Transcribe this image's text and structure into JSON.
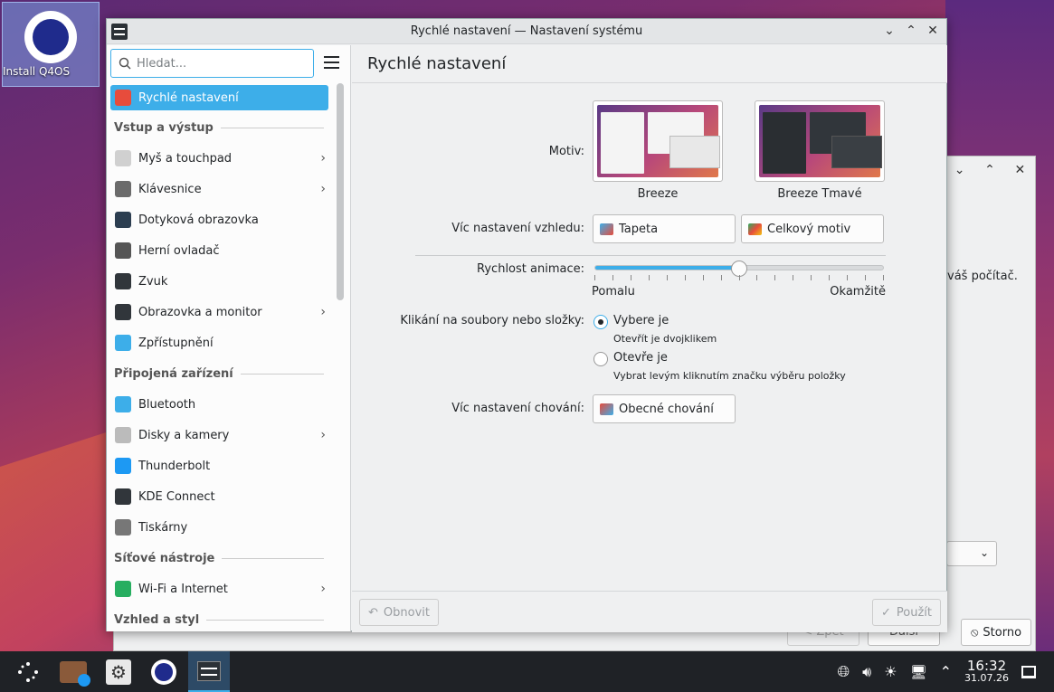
{
  "desktop": {
    "icon_label": "Install Q4OS"
  },
  "back_window": {
    "text": "váš počítač.",
    "combo": "⌄",
    "zpet": "< Zpět",
    "dalsi": "Další",
    "storno": "Storno",
    "buttons": [
      "⌄",
      "⌃",
      "✕"
    ]
  },
  "window": {
    "title": "Rychlé nastavení — Nastavení systému",
    "controls": [
      "⌄",
      "⌃",
      "✕"
    ]
  },
  "sidebar": {
    "search_placeholder": "Hledat...",
    "items": [
      {
        "type": "item",
        "label": "Rychlé nastavení",
        "selected": true,
        "color": "#e74c3c"
      },
      {
        "type": "section",
        "label": "Vstup a výstup"
      },
      {
        "type": "item",
        "label": "Myš a touchpad",
        "chevron": true,
        "color": "#d0d0d0"
      },
      {
        "type": "item",
        "label": "Klávesnice",
        "chevron": true,
        "color": "#6b6b6b"
      },
      {
        "type": "item",
        "label": "Dotyková obrazovka",
        "color": "#2c3e50"
      },
      {
        "type": "item",
        "label": "Herní ovladač",
        "color": "#555"
      },
      {
        "type": "item",
        "label": "Zvuk",
        "color": "#31363b"
      },
      {
        "type": "item",
        "label": "Obrazovka a monitor",
        "chevron": true,
        "color": "#31363b"
      },
      {
        "type": "item",
        "label": "Zpřístupnění",
        "color": "#3daee9"
      },
      {
        "type": "section",
        "label": "Připojená zařízení"
      },
      {
        "type": "item",
        "label": "Bluetooth",
        "color": "#3daee9"
      },
      {
        "type": "item",
        "label": "Disky a kamery",
        "chevron": true,
        "color": "#bbb"
      },
      {
        "type": "item",
        "label": "Thunderbolt",
        "color": "#1d99f3"
      },
      {
        "type": "item",
        "label": "KDE Connect",
        "color": "#31363b"
      },
      {
        "type": "item",
        "label": "Tiskárny",
        "color": "#777"
      },
      {
        "type": "section",
        "label": "Síťové nástroje"
      },
      {
        "type": "item",
        "label": "Wi-Fi a Internet",
        "chevron": true,
        "color": "#27ae60"
      },
      {
        "type": "section",
        "label": "Vzhled a styl"
      }
    ]
  },
  "page": {
    "heading": "Rychlé nastavení",
    "motiv_label": "Motiv:",
    "themes": [
      {
        "name": "Breeze"
      },
      {
        "name": "Breeze Tmavé"
      }
    ],
    "appearance_label": "Víc nastavení vzhledu:",
    "btn_tapeta": "Tapeta",
    "btn_celkovy": "Celkový motiv",
    "anim_label": "Rychlost animace:",
    "anim_slow": "Pomalu",
    "anim_fast": "Okamžitě",
    "anim_value_fraction": 0.5,
    "click_label": "Klikání na soubory nebo složky:",
    "radio1": "Vybere je",
    "radio1_hint": "Otevřít je dvojklikem",
    "radio2": "Otevře je",
    "radio2_hint": "Vybrat levým kliknutím značku výběru položky",
    "behavior_label": "Víc nastavení chování:",
    "btn_obecne": "Obecné chování"
  },
  "footer": {
    "reset": "Obnovit",
    "apply": "Použít"
  },
  "taskbar": {
    "time": "16:32",
    "date": "31.07.26"
  }
}
